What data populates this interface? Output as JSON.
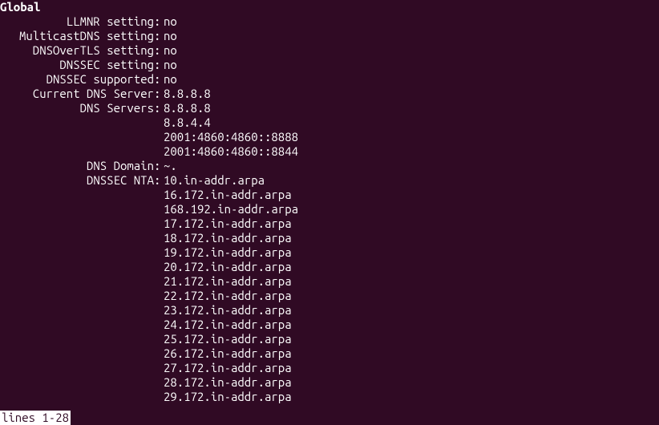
{
  "header": "Global",
  "rows": [
    {
      "label": "LLMNR setting",
      "value": "no"
    },
    {
      "label": "MulticastDNS setting",
      "value": "no"
    },
    {
      "label": "DNSOverTLS setting",
      "value": "no"
    },
    {
      "label": "DNSSEC setting",
      "value": "no"
    },
    {
      "label": "DNSSEC supported",
      "value": "no"
    },
    {
      "label": "Current DNS Server",
      "value": "8.8.8.8"
    },
    {
      "label": "DNS Servers",
      "value": "8.8.8.8"
    },
    {
      "label": "",
      "value": "8.8.4.4"
    },
    {
      "label": "",
      "value": "2001:4860:4860::8888"
    },
    {
      "label": "",
      "value": "2001:4860:4860::8844"
    },
    {
      "label": "DNS Domain",
      "value": "~."
    },
    {
      "label": "DNSSEC NTA",
      "value": "10.in-addr.arpa"
    },
    {
      "label": "",
      "value": "16.172.in-addr.arpa"
    },
    {
      "label": "",
      "value": "168.192.in-addr.arpa"
    },
    {
      "label": "",
      "value": "17.172.in-addr.arpa"
    },
    {
      "label": "",
      "value": "18.172.in-addr.arpa"
    },
    {
      "label": "",
      "value": "19.172.in-addr.arpa"
    },
    {
      "label": "",
      "value": "20.172.in-addr.arpa"
    },
    {
      "label": "",
      "value": "21.172.in-addr.arpa"
    },
    {
      "label": "",
      "value": "22.172.in-addr.arpa"
    },
    {
      "label": "",
      "value": "23.172.in-addr.arpa"
    },
    {
      "label": "",
      "value": "24.172.in-addr.arpa"
    },
    {
      "label": "",
      "value": "25.172.in-addr.arpa"
    },
    {
      "label": "",
      "value": "26.172.in-addr.arpa"
    },
    {
      "label": "",
      "value": "27.172.in-addr.arpa"
    },
    {
      "label": "",
      "value": "28.172.in-addr.arpa"
    },
    {
      "label": "",
      "value": "29.172.in-addr.arpa"
    }
  ],
  "status_line": "lines 1-28"
}
